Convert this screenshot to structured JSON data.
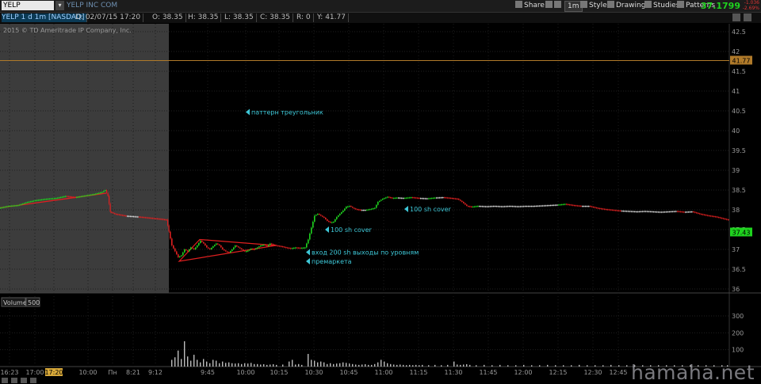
{
  "toolbar": {
    "symbol": "YELP",
    "company": "YELP INC COM",
    "share_label": "Share",
    "interval_label": "1m",
    "style_label": "Style",
    "drawings_label": "Drawings",
    "studies_label": "Studies",
    "patterns_label": "Patterns",
    "last_price": "37.1799",
    "mini_change_1": "-1.036",
    "mini_change_2": "-2.69%"
  },
  "infobar": {
    "chart_desc": "YELP 1 d 1m [NASDAQ]",
    "date": "D: 02/07/15 17:20",
    "open": "O: 38.35",
    "high": "H: 38.35",
    "low": "L: 38.35",
    "close": "C: 38.35",
    "range": "R: 0",
    "yval": "Y: 41.77"
  },
  "copyright": "2015 © TD Ameritrade IP Company, Inc.",
  "volume_panel": {
    "label": "Volume",
    "value": "500"
  },
  "watermark": "hamaha.net",
  "colors": {
    "up": "#1ed31e",
    "down": "#e02020",
    "flat": "#dcdcdc",
    "accent_cyan": "#3ec8d8",
    "trend_red": "#e02020"
  },
  "chart_data": [
    {
      "type": "candlestick",
      "title": "",
      "ylim": [
        35.9,
        42.7
      ],
      "yticks": [
        36,
        36.5,
        37,
        37.5,
        38,
        38.5,
        39,
        39.5,
        40,
        40.5,
        41,
        41.5,
        42,
        42.5
      ],
      "ytick_labels": [
        "36",
        "36.5",
        "37",
        "37.5",
        "38",
        "38.5",
        "39",
        "39.5",
        "40",
        "40.5",
        "41",
        "41.5",
        "42",
        "42.5"
      ],
      "xtick_labels": [
        "16:23",
        "17:00",
        "17:20",
        "10:00",
        "Пн",
        "8:21",
        "9:12",
        "9:45",
        "10:00",
        "10:15",
        "10:30",
        "10:45",
        "11:00",
        "11:15",
        "11:30",
        "11:45",
        "12:00",
        "12:15",
        "12:30",
        "12:45"
      ],
      "highlighted_xtick": "17:20",
      "horizontal_line": {
        "value": 41.77,
        "label": "41.77"
      },
      "current_price": {
        "value": 37.43,
        "label": "37.43"
      },
      "price_path": [
        [
          0,
          38.05
        ],
        [
          12,
          38.1
        ],
        [
          24,
          38.12
        ],
        [
          36,
          38.2
        ],
        [
          48,
          38.25
        ],
        [
          60,
          38.28
        ],
        [
          72,
          38.3
        ],
        [
          84,
          38.35
        ],
        [
          96,
          38.32
        ],
        [
          108,
          38.36
        ],
        [
          120,
          38.4
        ],
        [
          130,
          38.45
        ],
        [
          134,
          38.5
        ],
        [
          137,
          38.35
        ],
        [
          140,
          37.95
        ],
        [
          146,
          37.9
        ],
        [
          160,
          37.85
        ],
        [
          175,
          37.83
        ],
        [
          190,
          37.8
        ],
        [
          205,
          37.77
        ],
        [
          211,
          37.75
        ],
        [
          214,
          37.45
        ],
        [
          218,
          37.1
        ],
        [
          222,
          36.95
        ],
        [
          226,
          36.8
        ],
        [
          230,
          36.85
        ],
        [
          234,
          37.0
        ],
        [
          238,
          36.95
        ],
        [
          242,
          37.05
        ],
        [
          246,
          37.0
        ],
        [
          250,
          37.1
        ],
        [
          254,
          37.22
        ],
        [
          258,
          37.15
        ],
        [
          262,
          37.05
        ],
        [
          266,
          37.0
        ],
        [
          270,
          37.08
        ],
        [
          274,
          37.15
        ],
        [
          278,
          37.1
        ],
        [
          282,
          37.0
        ],
        [
          286,
          36.95
        ],
        [
          290,
          36.92
        ],
        [
          294,
          37.0
        ],
        [
          298,
          37.1
        ],
        [
          302,
          37.05
        ],
        [
          306,
          37.0
        ],
        [
          310,
          36.95
        ],
        [
          314,
          36.97
        ],
        [
          318,
          37.02
        ],
        [
          322,
          37.0
        ],
        [
          326,
          37.05
        ],
        [
          330,
          37.1
        ],
        [
          334,
          37.12
        ],
        [
          338,
          37.08
        ],
        [
          342,
          37.15
        ],
        [
          346,
          37.12
        ],
        [
          350,
          37.1
        ],
        [
          356,
          37.08
        ],
        [
          362,
          37.05
        ],
        [
          368,
          37.03
        ],
        [
          374,
          37.05
        ],
        [
          380,
          37.04
        ],
        [
          386,
          37.05
        ],
        [
          390,
          37.25
        ],
        [
          394,
          37.55
        ],
        [
          398,
          37.85
        ],
        [
          402,
          37.9
        ],
        [
          406,
          37.85
        ],
        [
          410,
          37.8
        ],
        [
          414,
          37.72
        ],
        [
          418,
          37.68
        ],
        [
          422,
          37.7
        ],
        [
          426,
          37.82
        ],
        [
          430,
          37.9
        ],
        [
          434,
          37.98
        ],
        [
          438,
          38.08
        ],
        [
          442,
          38.1
        ],
        [
          446,
          38.05
        ],
        [
          450,
          38.02
        ],
        [
          456,
          38.0
        ],
        [
          462,
          38.0
        ],
        [
          468,
          38.02
        ],
        [
          474,
          38.05
        ],
        [
          478,
          38.2
        ],
        [
          484,
          38.28
        ],
        [
          490,
          38.33
        ],
        [
          496,
          38.3
        ],
        [
          502,
          38.31
        ],
        [
          510,
          38.3
        ],
        [
          520,
          38.32
        ],
        [
          530,
          38.3
        ],
        [
          540,
          38.29
        ],
        [
          550,
          38.31
        ],
        [
          560,
          38.32
        ],
        [
          570,
          38.3
        ],
        [
          578,
          38.28
        ],
        [
          584,
          38.2
        ],
        [
          590,
          38.1
        ],
        [
          596,
          38.08
        ],
        [
          604,
          38.1
        ],
        [
          614,
          38.09
        ],
        [
          624,
          38.1
        ],
        [
          634,
          38.09
        ],
        [
          644,
          38.1
        ],
        [
          654,
          38.09
        ],
        [
          664,
          38.1
        ],
        [
          674,
          38.1
        ],
        [
          684,
          38.11
        ],
        [
          694,
          38.12
        ],
        [
          704,
          38.13
        ],
        [
          714,
          38.15
        ],
        [
          724,
          38.12
        ],
        [
          734,
          38.1
        ],
        [
          744,
          38.1
        ],
        [
          754,
          38.05
        ],
        [
          764,
          38.02
        ],
        [
          774,
          38.0
        ],
        [
          784,
          37.98
        ],
        [
          794,
          37.97
        ],
        [
          804,
          37.96
        ],
        [
          814,
          37.97
        ],
        [
          824,
          37.96
        ],
        [
          834,
          37.95
        ],
        [
          844,
          37.96
        ],
        [
          854,
          37.97
        ],
        [
          864,
          37.95
        ],
        [
          874,
          37.96
        ],
        [
          884,
          37.9
        ],
        [
          894,
          37.86
        ],
        [
          904,
          37.83
        ],
        [
          914,
          37.78
        ],
        [
          920,
          37.75
        ]
      ],
      "trendline": {
        "from": [
          0,
          38.05
        ],
        "to": [
          134,
          38.42
        ]
      },
      "triangle": {
        "points": [
          [
            226,
            36.7
          ],
          [
            252,
            37.25
          ],
          [
            348,
            37.1
          ]
        ]
      },
      "annotations": [
        {
          "text": "паттерн треугольник",
          "x": 316,
          "price": 40.47
        },
        {
          "text": "100 sh cover",
          "x": 516,
          "price": 38.02
        },
        {
          "text": "100 sh cover",
          "x": 416,
          "price": 37.5
        },
        {
          "text": "вход 200 sh выходы по уровням",
          "x": 392,
          "price": 36.93
        },
        {
          "text": "премаркета",
          "x": 392,
          "price": 36.7
        }
      ]
    },
    {
      "type": "bar",
      "title": "Volume",
      "ylim": [
        0,
        380
      ],
      "yticks": [
        100,
        200,
        300
      ],
      "ytick_labels": [
        "100",
        "200",
        "300"
      ],
      "bars": [
        [
          216,
          40
        ],
        [
          220,
          55
        ],
        [
          224,
          95
        ],
        [
          228,
          45
        ],
        [
          232,
          150
        ],
        [
          236,
          60
        ],
        [
          240,
          35
        ],
        [
          244,
          70
        ],
        [
          248,
          40
        ],
        [
          252,
          25
        ],
        [
          256,
          45
        ],
        [
          260,
          30
        ],
        [
          264,
          20
        ],
        [
          268,
          40
        ],
        [
          272,
          35
        ],
        [
          276,
          20
        ],
        [
          280,
          30
        ],
        [
          284,
          22
        ],
        [
          288,
          25
        ],
        [
          292,
          20
        ],
        [
          296,
          18
        ],
        [
          300,
          20
        ],
        [
          304,
          15
        ],
        [
          308,
          20
        ],
        [
          312,
          18
        ],
        [
          316,
          22
        ],
        [
          320,
          15
        ],
        [
          324,
          15
        ],
        [
          328,
          12
        ],
        [
          332,
          14
        ],
        [
          336,
          10
        ],
        [
          340,
          12
        ],
        [
          344,
          14
        ],
        [
          348,
          10
        ],
        [
          356,
          12
        ],
        [
          364,
          30
        ],
        [
          368,
          40
        ],
        [
          372,
          12
        ],
        [
          376,
          15
        ],
        [
          380,
          10
        ],
        [
          388,
          75
        ],
        [
          392,
          40
        ],
        [
          396,
          35
        ],
        [
          400,
          25
        ],
        [
          404,
          30
        ],
        [
          408,
          25
        ],
        [
          412,
          15
        ],
        [
          416,
          20
        ],
        [
          420,
          15
        ],
        [
          424,
          18
        ],
        [
          428,
          20
        ],
        [
          432,
          25
        ],
        [
          436,
          22
        ],
        [
          440,
          18
        ],
        [
          444,
          15
        ],
        [
          448,
          12
        ],
        [
          452,
          10
        ],
        [
          456,
          12
        ],
        [
          460,
          14
        ],
        [
          464,
          10
        ],
        [
          468,
          10
        ],
        [
          472,
          15
        ],
        [
          476,
          25
        ],
        [
          480,
          40
        ],
        [
          484,
          30
        ],
        [
          488,
          20
        ],
        [
          492,
          15
        ],
        [
          496,
          12
        ],
        [
          500,
          10
        ],
        [
          504,
          12
        ],
        [
          508,
          10
        ],
        [
          512,
          8
        ],
        [
          516,
          10
        ],
        [
          520,
          8
        ],
        [
          524,
          10
        ],
        [
          528,
          8
        ],
        [
          532,
          10
        ],
        [
          540,
          8
        ],
        [
          548,
          10
        ],
        [
          556,
          8
        ],
        [
          564,
          10
        ],
        [
          572,
          30
        ],
        [
          576,
          12
        ],
        [
          580,
          10
        ],
        [
          584,
          12
        ],
        [
          588,
          14
        ],
        [
          592,
          10
        ],
        [
          600,
          8
        ],
        [
          610,
          10
        ],
        [
          620,
          8
        ],
        [
          630,
          10
        ],
        [
          640,
          8
        ],
        [
          650,
          8
        ],
        [
          660,
          10
        ],
        [
          670,
          8
        ],
        [
          680,
          8
        ],
        [
          690,
          10
        ],
        [
          700,
          8
        ],
        [
          710,
          8
        ],
        [
          720,
          8
        ],
        [
          730,
          10
        ],
        [
          740,
          8
        ],
        [
          750,
          8
        ],
        [
          760,
          8
        ],
        [
          770,
          10
        ],
        [
          780,
          8
        ],
        [
          790,
          8
        ],
        [
          800,
          8
        ],
        [
          810,
          8
        ],
        [
          820,
          8
        ],
        [
          830,
          8
        ],
        [
          840,
          8
        ],
        [
          850,
          8
        ],
        [
          860,
          8
        ],
        [
          870,
          8
        ],
        [
          880,
          8
        ],
        [
          890,
          8
        ],
        [
          900,
          8
        ],
        [
          910,
          8
        ],
        [
          917,
          8
        ]
      ]
    }
  ]
}
